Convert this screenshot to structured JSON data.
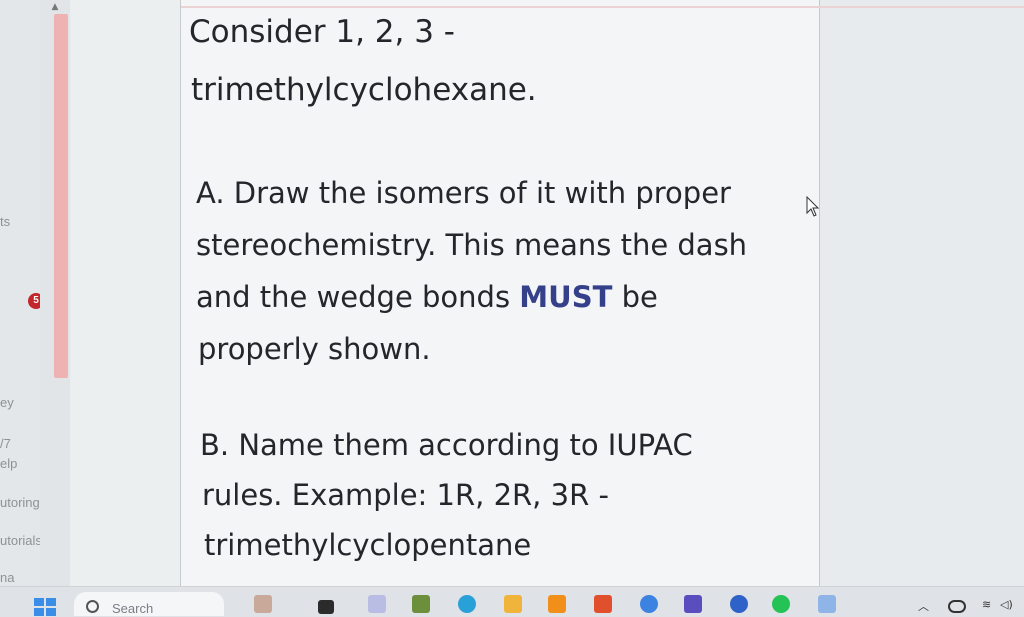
{
  "sidebar": {
    "items": [
      {
        "label": "ts"
      },
      {
        "label": "ey"
      },
      {
        "label": "/7"
      },
      {
        "label": "elp"
      },
      {
        "label": "utoring"
      },
      {
        "label": "utorials"
      },
      {
        "label": "na"
      }
    ],
    "badge_count": "5"
  },
  "document": {
    "title_line1": "Consider 1, 2, 3 -",
    "title_line2": "trimethylcyclohexane.",
    "partA": {
      "line1": "A. Draw the isomers of it with proper",
      "line2": "stereochemistry. This means the dash",
      "line3_pre": "and the wedge bonds ",
      "line3_emph": "MUST",
      "line3_post": " be",
      "line4": "properly shown."
    },
    "partB": {
      "line1": "B. Name them according to IUPAC",
      "line2": "rules. Example: 1R, 2R, 3R -",
      "line3": "trimethylcyclopentane"
    }
  },
  "taskbar": {
    "search_placeholder": "Search",
    "apps": [
      "widgets-icon",
      "file-explorer-icon",
      "teams-icon",
      "store-icon",
      "edge-icon",
      "folder-icon",
      "orange-app-icon",
      "office-icon",
      "chrome-icon",
      "proton-vpn-icon",
      "color-app-icon",
      "spotify-icon",
      "photos-icon"
    ],
    "tray": [
      "chevron-up-icon",
      "cloud-icon",
      "wifi-icon",
      "volume-icon"
    ]
  }
}
